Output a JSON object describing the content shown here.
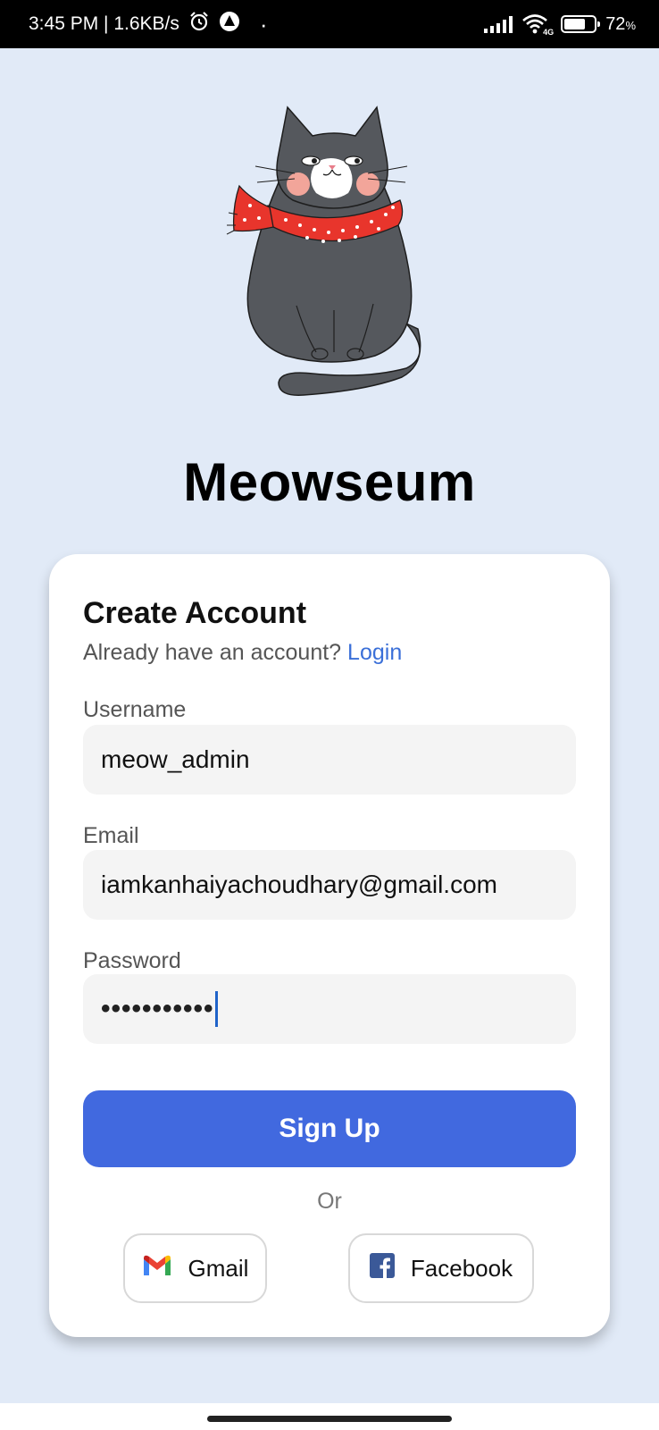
{
  "status_bar": {
    "time_speed": "3:45 PM | 1.6KB/s",
    "network_badge": "4G",
    "battery_percent": "72",
    "battery_unit": "%",
    "battery_level": 0.72
  },
  "app": {
    "title": "Meowseum"
  },
  "form": {
    "title": "Create Account",
    "login_prompt": "Already have an account?",
    "login_link": "Login",
    "username_label": "Username",
    "username_value": "meow_admin",
    "email_label": "Email",
    "email_value": "iamkanhaiyachoudhary@gmail.com",
    "password_label": "Password",
    "password_masked": "•••••••••••",
    "signup_label": "Sign Up",
    "or_text": "Or",
    "gmail_label": "Gmail",
    "facebook_label": "Facebook"
  },
  "colors": {
    "background": "#e1eaf7",
    "primary": "#4169df",
    "link": "#3a6fd8",
    "facebook": "#3b5998"
  },
  "icons": [
    "alarm-clock-icon",
    "app-notification-icon",
    "signal-icon",
    "wifi-icon",
    "battery-icon",
    "gmail-icon",
    "facebook-icon"
  ]
}
